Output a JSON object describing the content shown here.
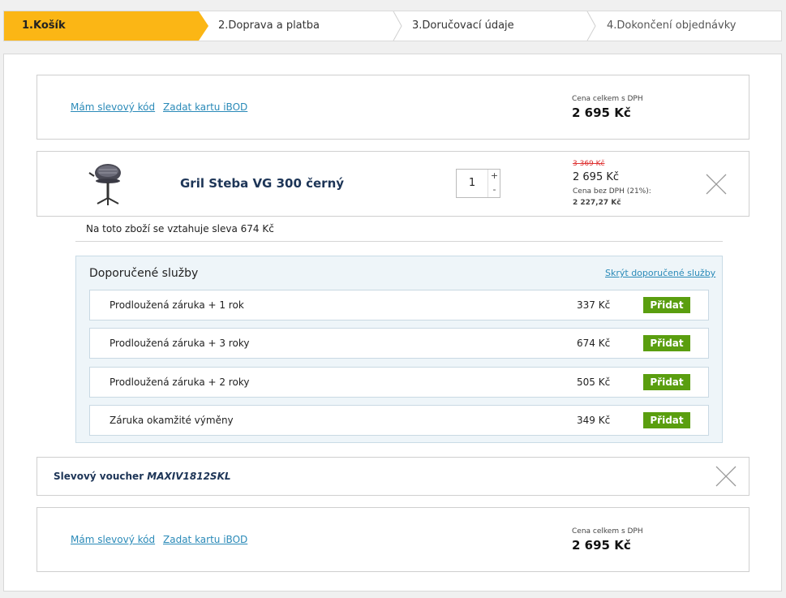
{
  "steps": [
    {
      "label": "1.Košík"
    },
    {
      "label": "2.Doprava a platba"
    },
    {
      "label": "3.Doručovací údaje"
    },
    {
      "label": "4.Dokončení objednávky"
    }
  ],
  "top_box": {
    "discount_code_link": "Mám slevový kód",
    "ibod_link": "Zadat kartu iBOD",
    "total_label": "Cena celkem s DPH",
    "total_value": "2 695 Kč"
  },
  "product": {
    "name": "Gril Steba VG 300 černý",
    "quantity": "1",
    "plus": "+",
    "minus": "-",
    "old_price": "3 369 Kč",
    "price": "2 695 Kč",
    "netto_label": "Cena bez DPH (21%):",
    "netto_value": "2 227,27 Kč",
    "image_icon": "grill-icon",
    "remove_icon": "close-icon"
  },
  "discount_note": "Na toto zboží se vztahuje sleva 674 Kč",
  "services": {
    "title": "Doporučené služby",
    "hide_link": "Skrýt doporučené služby",
    "items": [
      {
        "name": "Prodloužená záruka + 1 rok",
        "price": "337 Kč",
        "button": "Přidat"
      },
      {
        "name": "Prodloužená záruka + 3 roky",
        "price": "674 Kč",
        "button": "Přidat"
      },
      {
        "name": "Prodloužená záruka + 2 roky",
        "price": "505 Kč",
        "button": "Přidat"
      },
      {
        "name": "Záruka okamžité výměny",
        "price": "349 Kč",
        "button": "Přidat"
      }
    ]
  },
  "voucher": {
    "label": "Slevový voucher",
    "code": "MAXIV1812SKL"
  },
  "bottom_box": {
    "discount_code_link": "Mám slevový kód",
    "ibod_link": "Zadat kartu iBOD",
    "total_label": "Cena celkem s DPH",
    "total_value": "2 695 Kč"
  },
  "colors": {
    "active_step": "#fbb615",
    "link": "#2a8ab8",
    "add_button": "#5a9e0f",
    "product_name": "#1d3557",
    "old_price": "#dd3333"
  }
}
